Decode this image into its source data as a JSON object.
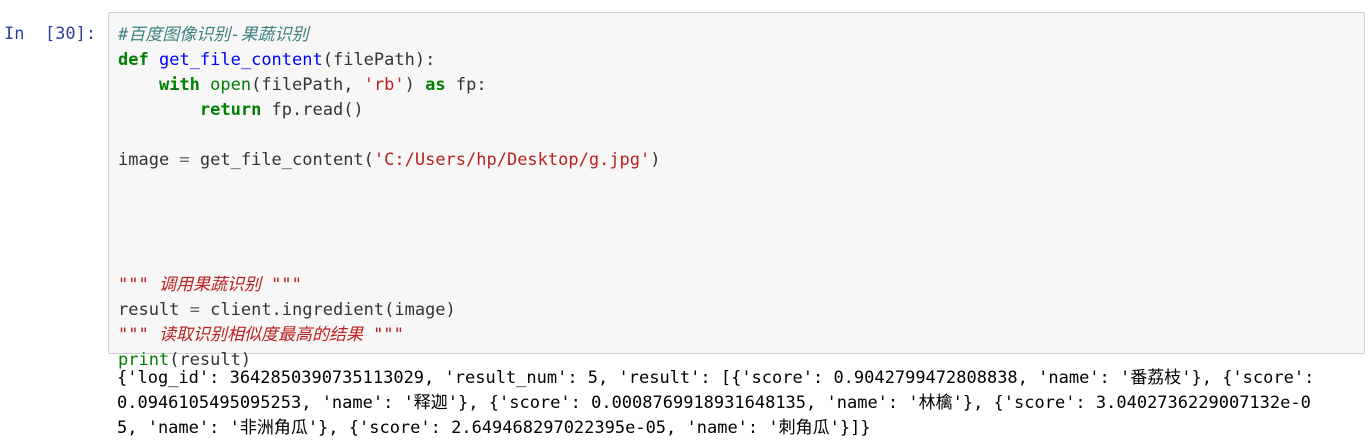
{
  "prompt": "In  [30]:",
  "code_lines": [
    [
      {
        "t": "#百度图像识别-果蔬识别",
        "c": "comment"
      }
    ],
    [
      {
        "t": "def",
        "c": "kw"
      },
      {
        "t": " ",
        "c": ""
      },
      {
        "t": "get_file_content",
        "c": "fn"
      },
      {
        "t": "(filePath):",
        "c": ""
      }
    ],
    [
      {
        "t": "    ",
        "c": ""
      },
      {
        "t": "with",
        "c": "kw"
      },
      {
        "t": " ",
        "c": ""
      },
      {
        "t": "open",
        "c": "builtin"
      },
      {
        "t": "(filePath, ",
        "c": ""
      },
      {
        "t": "'rb'",
        "c": "str"
      },
      {
        "t": ") ",
        "c": ""
      },
      {
        "t": "as",
        "c": "kw"
      },
      {
        "t": " fp:",
        "c": ""
      }
    ],
    [
      {
        "t": "        ",
        "c": ""
      },
      {
        "t": "return",
        "c": "kw"
      },
      {
        "t": " fp.read()",
        "c": ""
      }
    ],
    [],
    [
      {
        "t": "image ",
        "c": ""
      },
      {
        "t": "=",
        "c": "op"
      },
      {
        "t": " get_file_content(",
        "c": ""
      },
      {
        "t": "'C:/Users/hp/Desktop/g.jpg'",
        "c": "str"
      },
      {
        "t": ")",
        "c": ""
      }
    ],
    [],
    [],
    [],
    [],
    [
      {
        "t": "\"\"\" 调用果蔬识别 \"\"\"",
        "c": "doc"
      }
    ],
    [
      {
        "t": "result ",
        "c": ""
      },
      {
        "t": "=",
        "c": "op"
      },
      {
        "t": " client.ingredient(image)",
        "c": ""
      }
    ],
    [
      {
        "t": "\"\"\" 读取识别相似度最高的结果 \"\"\"",
        "c": "doc"
      }
    ],
    [
      {
        "t": "print",
        "c": "builtin"
      },
      {
        "t": "(result)",
        "c": ""
      }
    ]
  ],
  "output_lines": [
    "{'log_id': 3642850390735113029, 'result_num': 5, 'result': [{'score': 0.9042799472808838, 'name': '番荔枝'}, {'score':",
    "0.0946105495095253, 'name': '释迦'}, {'score': 0.0008769918931648135, 'name': '林檎'}, {'score': 3.0402736229007132e-0",
    "5, 'name': '非洲角瓜'}, {'score': 2.649468297022395e-05, 'name': '刺角瓜'}]}"
  ]
}
